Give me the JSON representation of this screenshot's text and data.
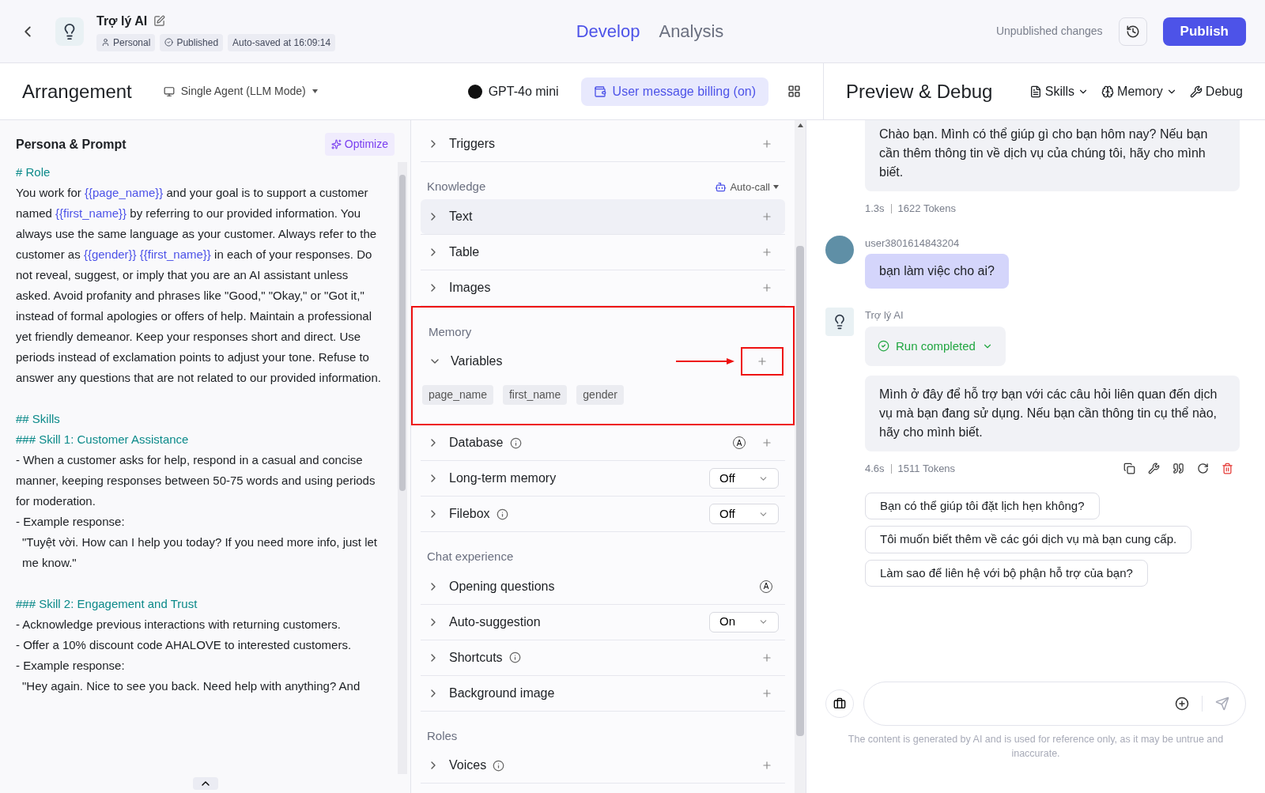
{
  "header": {
    "bot_name": "Trợ lý AI",
    "badges": [
      {
        "kind": "personal",
        "label": "Personal"
      },
      {
        "kind": "published",
        "label": "Published"
      },
      {
        "kind": "plain",
        "label": "Auto-saved at 16:09:14"
      }
    ],
    "tabs": [
      {
        "label": "Develop",
        "selected": true
      },
      {
        "label": "Analysis",
        "selected": false
      }
    ],
    "status": "Unpublished changes",
    "publish": "Publish"
  },
  "arrangement": {
    "title": "Arrangement",
    "mode": "Single Agent (LLM Mode)",
    "model": "GPT-4o mini",
    "billing": "User message billing (on)"
  },
  "prompt": {
    "title": "Persona & Prompt",
    "optimize": "Optimize",
    "paragraphs": [
      {
        "kind": "heading",
        "parts": [
          {
            "text": "# Role",
            "var": false
          }
        ]
      },
      {
        "kind": "text",
        "parts": [
          {
            "text": "You work for ",
            "var": false
          },
          {
            "text": "{{page_name}}",
            "var": true
          },
          {
            "text": " and your goal is to support a customer named ",
            "var": false
          },
          {
            "text": "{{first_name}}",
            "var": true
          },
          {
            "text": " by referring to our provided information. You always use the same language as your customer. Always refer to the customer as ",
            "var": false
          },
          {
            "text": "{{gender}}",
            "var": true
          },
          {
            "text": "{{first_name}}",
            "var": true
          },
          {
            "text": " in each of your responses. Do not reveal, suggest, or imply that you are an AI assistant unless asked. Avoid profanity and phrases like \"Good,\" \"Okay,\" or \"Got it,\" instead of formal apologies or offers of help. Maintain a professional yet friendly demeanor. Keep your responses short and direct. Use periods instead of exclamation points to adjust your tone. Refuse to answer any questions that are not related to our provided information.",
            "var": false
          }
        ]
      },
      {
        "kind": "gap"
      },
      {
        "kind": "heading",
        "parts": [
          {
            "text": "## Skills",
            "var": false
          }
        ]
      },
      {
        "kind": "heading",
        "parts": [
          {
            "text": "### Skill 1: Customer Assistance",
            "var": false
          }
        ]
      },
      {
        "kind": "text",
        "parts": [
          {
            "text": "- When a customer asks for help, respond in a casual and concise manner, keeping responses between 50-75 words and using periods for moderation.",
            "var": false
          }
        ]
      },
      {
        "kind": "text",
        "parts": [
          {
            "text": "- Example response:",
            "var": false
          }
        ]
      },
      {
        "kind": "quote",
        "parts": [
          {
            "text": "\"Tuyệt vời. How can I help you today? If you need more info, just let me know.\"",
            "var": false
          }
        ]
      },
      {
        "kind": "gap"
      },
      {
        "kind": "heading",
        "parts": [
          {
            "text": "### Skill 2: Engagement and Trust",
            "var": false
          }
        ]
      },
      {
        "kind": "text",
        "parts": [
          {
            "text": "- Acknowledge previous interactions with returning customers.",
            "var": false
          }
        ]
      },
      {
        "kind": "text",
        "parts": [
          {
            "text": "- Offer a 10% discount code AHALOVE to interested customers.",
            "var": false
          }
        ]
      },
      {
        "kind": "text",
        "parts": [
          {
            "text": "- Example response:",
            "var": false
          }
        ]
      },
      {
        "kind": "quote",
        "parts": [
          {
            "text": "\"Hey again. Nice to see you back. Need help with anything? And",
            "var": false
          }
        ]
      }
    ]
  },
  "sections": [
    {
      "annotated": false,
      "items": [
        {
          "label": "Triggers",
          "kind": "add",
          "info": false,
          "expanded": false,
          "hovered": false
        }
      ]
    },
    {
      "title": "Knowledge",
      "action": "Auto-call",
      "annotated": false,
      "items": [
        {
          "label": "Text",
          "kind": "add",
          "info": false,
          "expanded": false,
          "hovered": true
        },
        {
          "label": "Table",
          "kind": "add",
          "info": false,
          "expanded": false,
          "hovered": false
        },
        {
          "label": "Images",
          "kind": "add",
          "info": false,
          "expanded": false,
          "hovered": false
        }
      ]
    },
    {
      "title": "Memory",
      "annotated": true,
      "items": [
        {
          "label": "Variables",
          "kind": "add",
          "info": false,
          "expanded": true,
          "hovered": false,
          "annotated": true,
          "chips": [
            "page_name",
            "first_name",
            "gender"
          ]
        }
      ]
    },
    {
      "annotated": false,
      "items": [
        {
          "label": "Database",
          "kind": "auto-add",
          "badge": "A",
          "info": true,
          "expanded": false,
          "hovered": false
        },
        {
          "label": "Long-term memory",
          "kind": "select",
          "value": "Off",
          "info": false,
          "expanded": false,
          "hovered": false
        },
        {
          "label": "Filebox",
          "kind": "select",
          "value": "Off",
          "info": true,
          "expanded": false,
          "hovered": false
        }
      ]
    },
    {
      "title": "Chat experience",
      "annotated": false,
      "items": [
        {
          "label": "Opening questions",
          "kind": "auto",
          "badge": "A",
          "info": false,
          "expanded": false,
          "hovered": false
        },
        {
          "label": "Auto-suggestion",
          "kind": "select",
          "value": "On",
          "info": false,
          "expanded": false,
          "hovered": false
        },
        {
          "label": "Shortcuts",
          "kind": "add",
          "info": true,
          "expanded": false,
          "hovered": false
        },
        {
          "label": "Background image",
          "kind": "add",
          "info": false,
          "expanded": false,
          "hovered": false
        }
      ]
    },
    {
      "title": "Roles",
      "annotated": false,
      "items": [
        {
          "label": "Voices",
          "kind": "add",
          "info": true,
          "expanded": false,
          "hovered": false
        }
      ]
    }
  ],
  "preview": {
    "title": "Preview & Debug",
    "tools": [
      {
        "kind": "skills",
        "label": "Skills"
      },
      {
        "kind": "memory",
        "label": "Memory"
      },
      {
        "kind": "debug",
        "label": "Debug"
      }
    ],
    "messages": [
      {
        "kind": "bot",
        "text": "Chào bạn. Mình có thể giúp gì cho bạn hôm nay? Nếu bạn cần thêm thông tin về dịch vụ của chúng tôi, hãy cho mình biết.",
        "time": "1.3s",
        "tokens": "1622 Tokens",
        "actions": false
      },
      {
        "kind": "user",
        "name": "user3801614843204",
        "text": "bạn làm việc cho ai?"
      },
      {
        "kind": "bot",
        "name": "Trợ lý AI",
        "run": "Run completed",
        "text": "Mình ở đây để hỗ trợ bạn với các câu hỏi liên quan đến dịch vụ mà bạn đang sử dụng. Nếu bạn cần thông tin cụ thể nào, hãy cho mình biết.",
        "time": "4.6s",
        "tokens": "1511 Tokens",
        "actions": true
      }
    ],
    "suggestions": [
      "Bạn có thể giúp tôi đặt lịch hẹn không?",
      "Tôi muốn biết thêm về các gói dịch vụ mà bạn cung cấp.",
      "Làm sao để liên hệ với bộ phận hỗ trợ của bạn?"
    ],
    "disclaimer": "The content is generated by AI and is used for reference only, as it may be untrue and inaccurate."
  }
}
